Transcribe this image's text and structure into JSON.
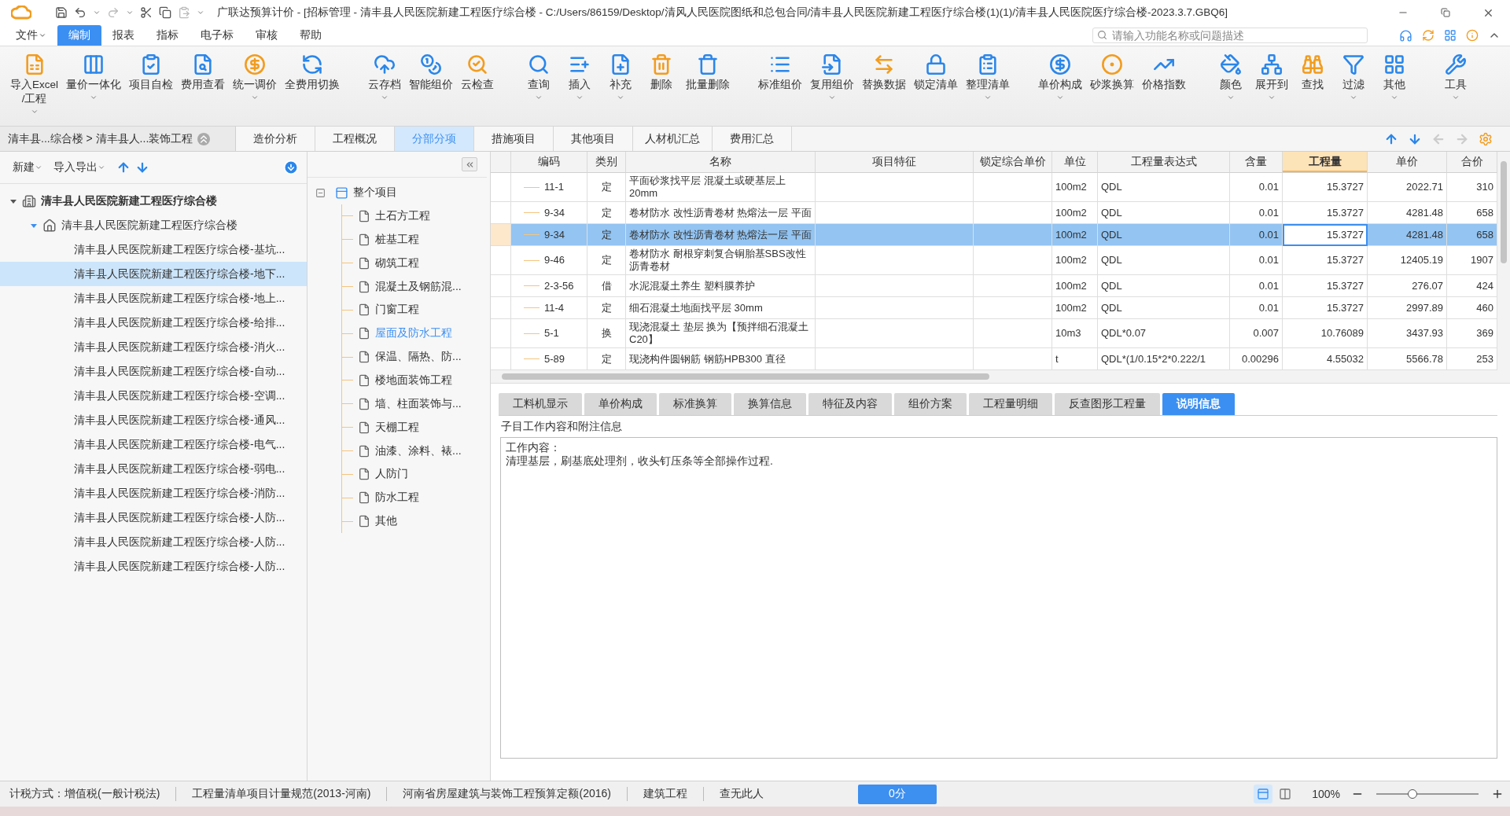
{
  "title_bar": {
    "title": "广联达预算计价 - [招标管理 - 清丰县人民医院新建工程医疗综合楼 - C:/Users/86159/Desktop/清风人民医院图纸和总包合同/清丰县人民医院新建工程医疗综合楼(1)(1)/清丰县人民医院医疗综合楼-2023.3.7.GBQ6]"
  },
  "menu": {
    "items": [
      {
        "label": "文件",
        "selected": false,
        "has_menu": true
      },
      {
        "label": "编制",
        "selected": true,
        "has_menu": false
      },
      {
        "label": "报表",
        "selected": false,
        "has_menu": false
      },
      {
        "label": "指标",
        "selected": false,
        "has_menu": false
      },
      {
        "label": "电子标",
        "selected": false,
        "has_menu": false
      },
      {
        "label": "审核",
        "selected": false,
        "has_menu": false
      },
      {
        "label": "帮助",
        "selected": false,
        "has_menu": false
      }
    ],
    "search": {
      "placeholder": "请输入功能名称或问题描述"
    }
  },
  "toolbar": {
    "groups": [
      {
        "items": [
          {
            "label": "导入Excel\n/工程",
            "has_menu": true
          },
          {
            "label": "量价一体化",
            "has_menu": true
          },
          {
            "label": "项目自检",
            "has_menu": false
          },
          {
            "label": "费用查看",
            "has_menu": false
          },
          {
            "label": "统一调价",
            "has_menu": true
          },
          {
            "label": "全费用切换",
            "has_menu": false
          }
        ]
      },
      {
        "items": [
          {
            "label": "云存档",
            "has_menu": true
          },
          {
            "label": "智能组价",
            "has_menu": false
          },
          {
            "label": "云检查",
            "has_menu": false
          }
        ]
      },
      {
        "items": [
          {
            "label": "查询",
            "has_menu": true
          },
          {
            "label": "插入",
            "has_menu": true
          },
          {
            "label": "补充",
            "has_menu": true
          },
          {
            "label": "删除",
            "has_menu": false
          },
          {
            "label": "批量删除",
            "has_menu": false
          }
        ]
      },
      {
        "items": [
          {
            "label": "标准组价",
            "has_menu": false
          },
          {
            "label": "复用组价",
            "has_menu": true
          },
          {
            "label": "替换数据",
            "has_menu": false
          },
          {
            "label": "锁定清单",
            "has_menu": false
          },
          {
            "label": "整理清单",
            "has_menu": true
          }
        ]
      },
      {
        "items": [
          {
            "label": "单价构成",
            "has_menu": true
          },
          {
            "label": "砂浆换算",
            "has_menu": false
          },
          {
            "label": "价格指数",
            "has_menu": false
          }
        ]
      },
      {
        "items": [
          {
            "label": "颜色",
            "has_menu": true
          },
          {
            "label": "展开到",
            "has_menu": true
          },
          {
            "label": "查找",
            "has_menu": false
          },
          {
            "label": "过滤",
            "has_menu": true
          },
          {
            "label": "其他",
            "has_menu": true
          }
        ]
      },
      {
        "items": [
          {
            "label": "工具",
            "has_menu": true
          }
        ]
      }
    ]
  },
  "view_tabs": {
    "breadcrumb": "清丰县...综合楼 > 清丰县人...装饰工程",
    "tabs": [
      {
        "label": "造价分析",
        "selected": false
      },
      {
        "label": "工程概况",
        "selected": false
      },
      {
        "label": "分部分项",
        "selected": true
      },
      {
        "label": "措施项目",
        "selected": false
      },
      {
        "label": "其他项目",
        "selected": false
      },
      {
        "label": "人材机汇总",
        "selected": false
      },
      {
        "label": "费用汇总",
        "selected": false
      }
    ]
  },
  "project_tree": {
    "toolbar": [
      {
        "label": "新建",
        "has_menu": true
      },
      {
        "label": "导入导出",
        "has_menu": true
      }
    ],
    "root": {
      "label": "清丰县人民医院新建工程医疗综合楼",
      "expanded": true,
      "children": [
        {
          "label": "清丰县人民医院新建工程医疗综合楼",
          "expanded": true,
          "children": [
            {
              "label": "清丰县人民医院新建工程医疗综合楼-基坑...",
              "selected": false
            },
            {
              "label": "清丰县人民医院新建工程医疗综合楼-地下...",
              "selected": true
            },
            {
              "label": "清丰县人民医院新建工程医疗综合楼-地上...",
              "selected": false
            },
            {
              "label": "清丰县人民医院新建工程医疗综合楼-给排...",
              "selected": false
            },
            {
              "label": "清丰县人民医院新建工程医疗综合楼-消火...",
              "selected": false
            },
            {
              "label": "清丰县人民医院新建工程医疗综合楼-自动...",
              "selected": false
            },
            {
              "label": "清丰县人民医院新建工程医疗综合楼-空调...",
              "selected": false
            },
            {
              "label": "清丰县人民医院新建工程医疗综合楼-通风...",
              "selected": false
            },
            {
              "label": "清丰县人民医院新建工程医疗综合楼-电气...",
              "selected": false
            },
            {
              "label": "清丰县人民医院新建工程医疗综合楼-弱电...",
              "selected": false
            },
            {
              "label": "清丰县人民医院新建工程医疗综合楼-消防...",
              "selected": false
            },
            {
              "label": "清丰县人民医院新建工程医疗综合楼-人防...",
              "selected": false
            },
            {
              "label": "清丰县人民医院新建工程医疗综合楼-人防...",
              "selected": false
            },
            {
              "label": "清丰县人民医院新建工程医疗综合楼-人防...",
              "selected": false
            }
          ]
        }
      ]
    }
  },
  "section_tree": {
    "root": {
      "label": "整个项目",
      "expanded": true,
      "children": [
        {
          "label": "土石方工程",
          "selected": false
        },
        {
          "label": "桩基工程",
          "selected": false
        },
        {
          "label": "砌筑工程",
          "selected": false
        },
        {
          "label": "混凝土及钢筋混...",
          "selected": false
        },
        {
          "label": "门窗工程",
          "selected": false
        },
        {
          "label": "屋面及防水工程",
          "selected": true
        },
        {
          "label": "保温、隔热、防...",
          "selected": false
        },
        {
          "label": "楼地面装饰工程",
          "selected": false
        },
        {
          "label": "墙、柱面装饰与...",
          "selected": false
        },
        {
          "label": "天棚工程",
          "selected": false
        },
        {
          "label": "油漆、涂料、裱...",
          "selected": false
        },
        {
          "label": "人防门",
          "selected": false
        },
        {
          "label": "防水工程",
          "selected": false
        },
        {
          "label": "其他",
          "selected": false
        }
      ]
    }
  },
  "table": {
    "columns": [
      {
        "label": "编码",
        "selected": false
      },
      {
        "label": "类别",
        "selected": false
      },
      {
        "label": "名称",
        "selected": false
      },
      {
        "label": "项目特征",
        "selected": false
      },
      {
        "label": "锁定综合单价",
        "selected": false
      },
      {
        "label": "单位",
        "selected": false
      },
      {
        "label": "工程量表达式",
        "selected": false
      },
      {
        "label": "含量",
        "selected": false
      },
      {
        "label": "工程量",
        "selected": true
      },
      {
        "label": "单价",
        "selected": false
      },
      {
        "label": "合价",
        "selected": false
      }
    ],
    "rows": [
      {
        "code": "11-1",
        "category": "定",
        "name": "平面砂浆找平层 混凝土或硬基层上20mm",
        "unit": "100m2",
        "expression": "QDL",
        "content": "0.01",
        "quantity": "15.3727",
        "unit_price": "2022.71",
        "total": "310",
        "selected": false
      },
      {
        "code": "9-34",
        "category": "定",
        "name": "卷材防水 改性沥青卷材 热熔法一层 平面",
        "unit": "100m2",
        "expression": "QDL",
        "content": "0.01",
        "quantity": "15.3727",
        "unit_price": "4281.48",
        "total": "658",
        "selected": false
      },
      {
        "code": "9-34",
        "category": "定",
        "name": "卷材防水 改性沥青卷材 热熔法一层 平面",
        "unit": "100m2",
        "expression": "QDL",
        "content": "0.01",
        "quantity": "15.3727",
        "unit_price": "4281.48",
        "total": "658",
        "selected": true
      },
      {
        "code": "9-46",
        "category": "定",
        "name": "卷材防水 耐根穿刺复合铜胎基SBS改性沥青卷材",
        "unit": "100m2",
        "expression": "QDL",
        "content": "0.01",
        "quantity": "15.3727",
        "unit_price": "12405.19",
        "total": "1907",
        "selected": false
      },
      {
        "code": "2-3-56",
        "category": "借",
        "name": "水泥混凝土养生 塑料膜养护",
        "unit": "100m2",
        "expression": "QDL",
        "content": "0.01",
        "quantity": "15.3727",
        "unit_price": "276.07",
        "total": "424",
        "selected": false
      },
      {
        "code": "11-4",
        "category": "定",
        "name": "细石混凝土地面找平层 30mm",
        "unit": "100m2",
        "expression": "QDL",
        "content": "0.01",
        "quantity": "15.3727",
        "unit_price": "2997.89",
        "total": "460",
        "selected": false
      },
      {
        "code": "5-1",
        "category": "换",
        "name": "现浇混凝土 垫层  换为【预拌细石混凝土C20】",
        "unit": "10m3",
        "expression": "QDL*0.07",
        "content": "0.007",
        "quantity": "10.76089",
        "unit_price": "3437.93",
        "total": "369",
        "selected": false
      },
      {
        "code": "5-89",
        "category": "定",
        "name": "现浇构件圆钢筋 钢筋HPB300 直径",
        "unit": "t",
        "expression": "QDL*(1/0.15*2*0.222/1",
        "content": "0.00296",
        "quantity": "4.55032",
        "unit_price": "5566.78",
        "total": "253",
        "selected": false
      }
    ]
  },
  "detail": {
    "tabs": [
      {
        "label": "工料机显示",
        "selected": false
      },
      {
        "label": "单价构成",
        "selected": false
      },
      {
        "label": "标准换算",
        "selected": false
      },
      {
        "label": "换算信息",
        "selected": false
      },
      {
        "label": "特征及内容",
        "selected": false
      },
      {
        "label": "组价方案",
        "selected": false
      },
      {
        "label": "工程量明细",
        "selected": false
      },
      {
        "label": "反查图形工程量",
        "selected": false
      },
      {
        "label": "说明信息",
        "selected": true
      }
    ],
    "heading": "子目工作内容和附注信息",
    "content": [
      "工作内容：",
      "清理基层，刷基底处理剂，收头钉压条等全部操作过程."
    ]
  },
  "status_bar": {
    "items": [
      "计税方式：增值税(一般计税法)",
      "工程量清单项目计量规范(2013-河南)",
      "河南省房屋建筑与装饰工程预算定额(2016)",
      "建筑工程",
      "查无此人"
    ],
    "score_button": "0分",
    "views": [
      {
        "selected": true
      },
      {
        "selected": false
      }
    ],
    "zoom": "100%",
    "zoom_slider": {
      "level": 0.35
    }
  }
}
